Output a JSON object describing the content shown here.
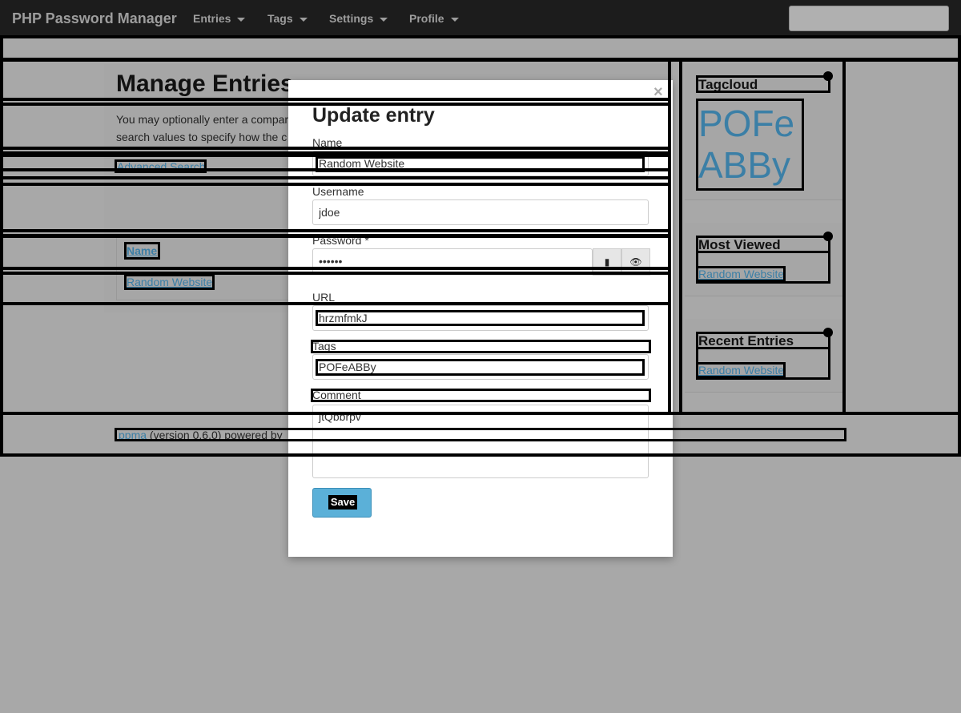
{
  "navbar": {
    "brand": "PHP Password Manager",
    "items": [
      {
        "label": "Entries"
      },
      {
        "label": "Tags"
      },
      {
        "label": "Settings"
      },
      {
        "label": "Profile"
      }
    ],
    "search_placeholder": ""
  },
  "main": {
    "title": "Manage Entries",
    "intro_line1": "You may optionally enter a compar",
    "intro_line2": "search values to specify how the c",
    "advanced_search": "Advanced Search",
    "table": {
      "header": "Name",
      "rows": [
        "Random Website"
      ]
    }
  },
  "sidebar": {
    "tagcloud": {
      "title": "Tagcloud",
      "tag": "POFeABBy"
    },
    "most_viewed": {
      "title": "Most Viewed",
      "items": [
        "Random Website"
      ]
    },
    "recent": {
      "title": "Recent Entries",
      "items": [
        "Random Website"
      ]
    }
  },
  "footer": {
    "link": "ppma",
    "text": " (version 0.6.0) powered by"
  },
  "modal": {
    "close": "×",
    "title": "Update entry",
    "fields": {
      "name": {
        "label": "Name",
        "value": "Random Website"
      },
      "username": {
        "label": "Username",
        "value": "jdoe"
      },
      "password": {
        "label": "Password *",
        "value": "••••••"
      },
      "url": {
        "label": "URL",
        "value": "hrzmfmkJ"
      },
      "tags": {
        "label": "Tags",
        "value": "POFeABBy"
      },
      "comment": {
        "label": "Comment",
        "value": "jtQbbrpv"
      }
    },
    "save_label": "Save"
  },
  "colors": {
    "navbar_bg": "#1c1c1c",
    "backdrop": "#a8a8a8",
    "link": "#3b7fa6",
    "save_button": "#5bb0d8"
  }
}
